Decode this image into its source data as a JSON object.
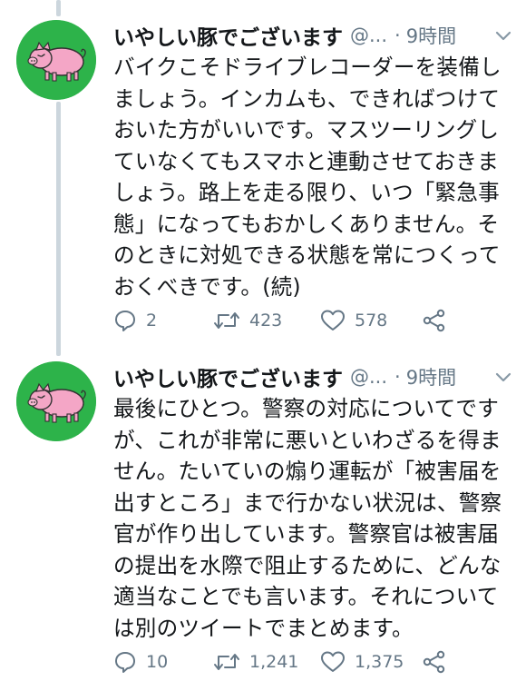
{
  "tweets": [
    {
      "display_name": "いやしい豚でございます",
      "handle": "@...",
      "separator": "·",
      "time": "9時間",
      "text": "バイクこそドライブレコーダーを装備しましょう。インカムも、できればつけておいた方がいいです。マスツーリングしていなくてもスマホと連動させておきましょう。路上を走る限り、いつ「緊急事態」になってもおかしくありません。そのときに対処できる状態を常につくっておくべきです。(続)",
      "replies": "2",
      "retweets": "423",
      "likes": "578"
    },
    {
      "display_name": "いやしい豚でございます",
      "handle": "@...",
      "separator": "·",
      "time": "9時間",
      "text": "最後にひとつ。警察の対応についてですが、これが非常に悪いといわざるを得ません。たいていの煽り運転が「被害届を出すところ」まで行かない状況は、警察官が作り出しています。警察官は被害届の提出を水際で阻止するために、どんな適当なことでも言います。それについては別のツイートでまとめます。",
      "replies": "10",
      "retweets": "1,241",
      "likes": "1,375"
    }
  ],
  "icons": {
    "reply": "reply-icon",
    "retweet": "retweet-icon",
    "like": "heart-icon",
    "share": "share-icon",
    "menu": "chevron-down-icon"
  },
  "colors": {
    "avatar_bg": "#2db34a",
    "pig": "#f4a6c6",
    "muted": "#657786",
    "thread_line": "#ccd6dd"
  }
}
